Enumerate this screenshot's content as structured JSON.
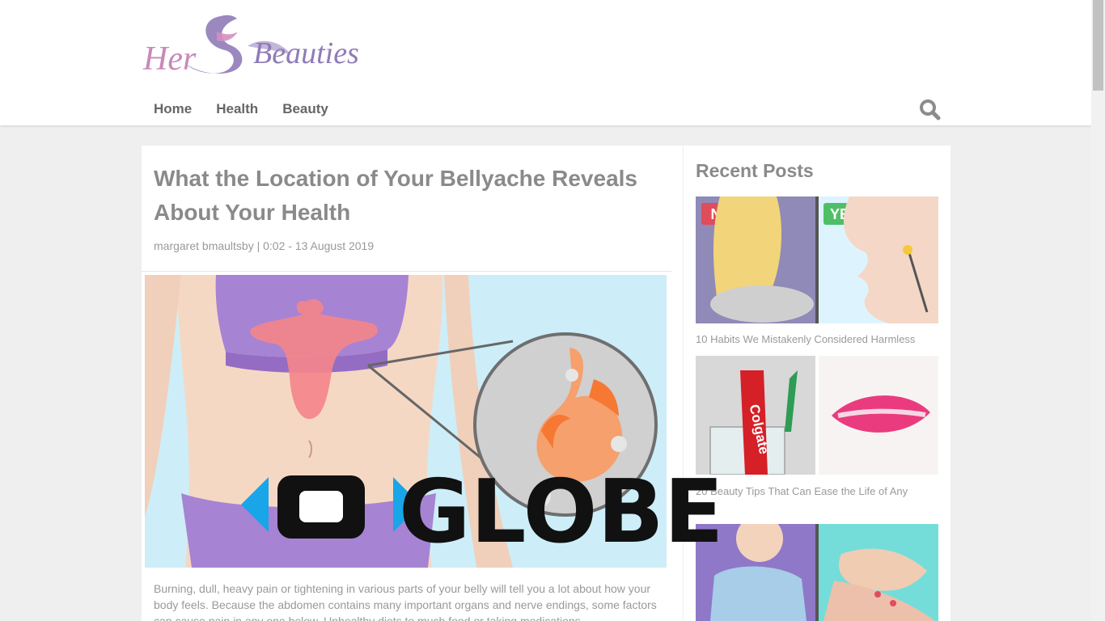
{
  "header": {
    "logo_text_1": "Her",
    "logo_text_2": "Beauties",
    "nav": [
      {
        "label": "Home"
      },
      {
        "label": "Health"
      },
      {
        "label": "Beauty"
      }
    ],
    "search_icon": "search-icon"
  },
  "article": {
    "title": "What the Location of Your Bellyache Reveals About Your Health",
    "meta": "margaret bmaultsby | 0:02 - 13 August 2019",
    "body": "Burning, dull, heavy pain or tightening in various parts of your belly will tell you a lot about how your body feels. Because the abdomen contains many important organs and nerve endings, some factors can cause pain in any one below. Unhealthy diets to much food or taking medications"
  },
  "sidebar": {
    "title": "Recent Posts",
    "posts": [
      {
        "title": "10 Habits We Mistakenly Considered Harmless",
        "badge_no": "NO",
        "badge_yes": "YES"
      },
      {
        "title": "20 Beauty Tips That Can Ease the Life of Any",
        "product_text": "Colgate"
      },
      {
        "title": ""
      }
    ]
  },
  "watermark": {
    "text": "GLOBE"
  },
  "colors": {
    "accent": "#8a8a8a",
    "logo_pink": "#c889b8",
    "logo_purple": "#8f7bb8",
    "belly_purple": "#a783d3",
    "sky": "#c8effa",
    "pain": "#f3858b"
  }
}
